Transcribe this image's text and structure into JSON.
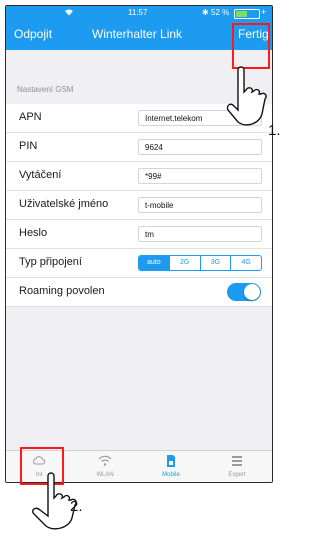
{
  "status_bar": {
    "time": "11:57",
    "battery_text": "52 %",
    "battery_level": 0.52,
    "icons": [
      "wifi-icon",
      "bluetooth-icon",
      "battery-icon"
    ]
  },
  "nav": {
    "left_label": "Odpojit",
    "title": "Winterhalter Link",
    "right_label": "Fertig"
  },
  "section_header": "Nastavení GSM",
  "fields": {
    "apn": {
      "label": "APN",
      "value": "Internet.telekom"
    },
    "pin": {
      "label": "PIN",
      "value": "9624"
    },
    "dial": {
      "label": "Vytáčení",
      "value": "*99#"
    },
    "user": {
      "label": "Uživatelské jméno",
      "value": "t-mobile"
    },
    "password": {
      "label": "Heslo",
      "value": "tm"
    }
  },
  "connection_type": {
    "label": "Typ připojení",
    "options": [
      "auto",
      "2G",
      "3G",
      "4G"
    ],
    "selected": "auto"
  },
  "roaming": {
    "label": "Roaming povolen",
    "enabled": true
  },
  "tabs": [
    {
      "label": "Int",
      "icon": "cloud-icon",
      "active": false
    },
    {
      "label": "WLAN",
      "icon": "wifi-icon",
      "active": false
    },
    {
      "label": "Mobile",
      "icon": "sim-card-icon",
      "active": true
    },
    {
      "label": "Expert",
      "icon": "list-icon",
      "active": false
    }
  ],
  "annotations": {
    "step1": "1.",
    "step2": "2.",
    "highlight_color": "#ff1a1a",
    "icon": "pointing-hand-icon"
  },
  "colors": {
    "accent": "#1d9bf0",
    "background": "#efeff4"
  }
}
